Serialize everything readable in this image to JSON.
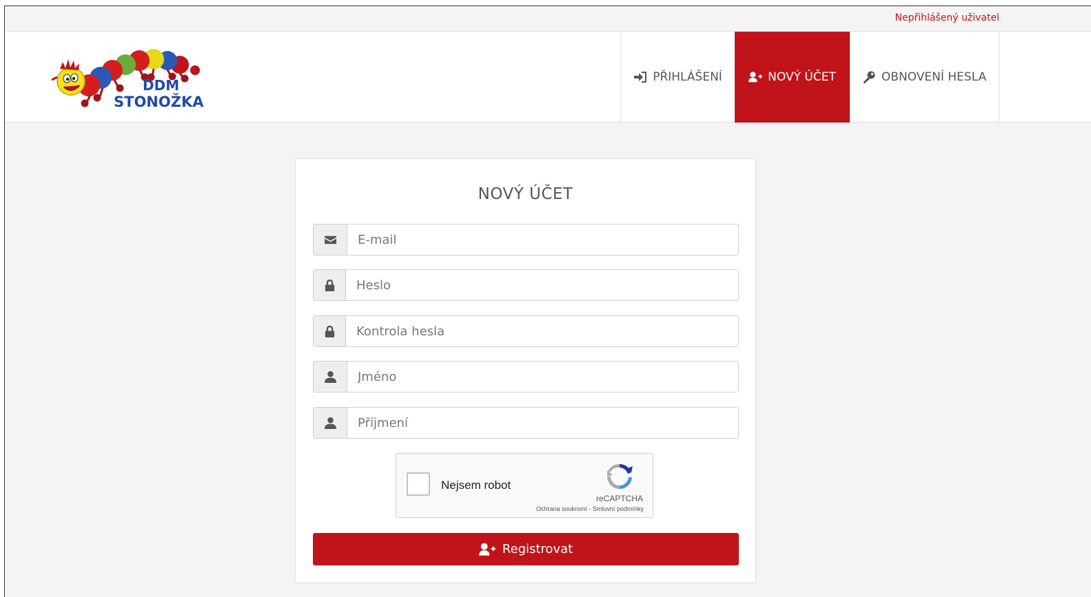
{
  "topbar": {
    "user_status": "Nepřihlášený uživatel"
  },
  "logo": {
    "line1": "DDM",
    "line2": "STONOŽKA"
  },
  "nav": {
    "login": {
      "label": "PŘIHLÁŠENÍ",
      "icon": "sign-in-icon"
    },
    "new_account": {
      "label": "NOVÝ ÚČET",
      "icon": "user-plus-icon",
      "active": true
    },
    "reset_password": {
      "label": "OBNOVENÍ HESLA",
      "icon": "key-icon"
    }
  },
  "form": {
    "title": "NOVÝ ÚČET",
    "fields": {
      "email": {
        "placeholder": "E-mail",
        "value": "",
        "icon": "envelope-icon"
      },
      "password": {
        "placeholder": "Heslo",
        "value": "",
        "icon": "lock-icon"
      },
      "password_confirm": {
        "placeholder": "Kontrola hesla",
        "value": "",
        "icon": "lock-icon"
      },
      "first_name": {
        "placeholder": "Jméno",
        "value": "",
        "icon": "user-icon"
      },
      "last_name": {
        "placeholder": "Příjmení",
        "value": "",
        "icon": "user-icon"
      }
    },
    "captcha": {
      "label": "Nejsem robot",
      "brand": "reCAPTCHA",
      "privacy": "Ochrana soukromí",
      "separator": " - ",
      "terms": "Smluvní podmínky"
    },
    "submit_label": "Registrovat"
  },
  "colors": {
    "accent": "#c0141a",
    "background": "#f4f4f4",
    "text": "#555555"
  }
}
